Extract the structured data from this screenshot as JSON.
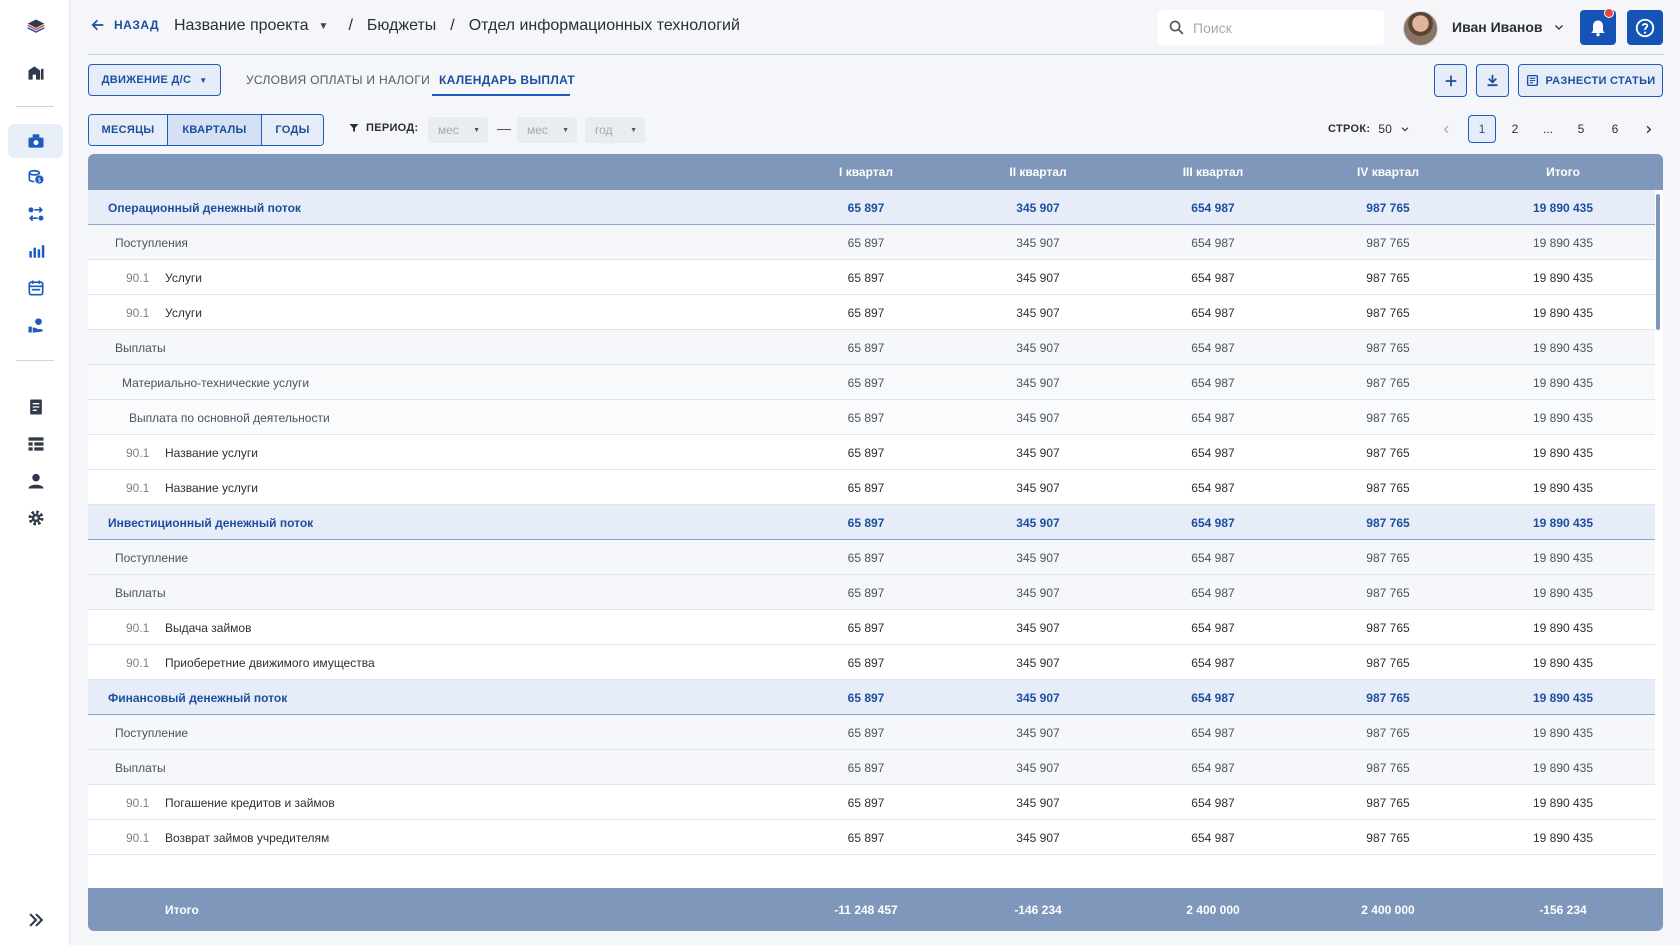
{
  "topbar": {
    "back_label": "НАЗАД",
    "breadcrumbs": [
      "Название проекта",
      "Бюджеты",
      "Отдел информационных технологий"
    ],
    "separator": "/",
    "search_placeholder": "Поиск",
    "user_name": "Иван Иванов"
  },
  "toolbar": {
    "dropdown_label": "ДВИЖЕНИЕ Д/С",
    "tabs": [
      "УСЛОВИЯ ОПЛАТЫ И НАЛОГИ",
      "КАЛЕНДАРЬ ВЫПЛАТ"
    ],
    "active_tab": "КАЛЕНДАРЬ ВЫПЛАТ",
    "action_label": "РАЗНЕСТИ СТАТЬИ"
  },
  "filters": {
    "granularity": [
      "МЕСЯЦЫ",
      "КВАРТАЛЫ",
      "ГОДЫ"
    ],
    "selected_granularity": "КВАРТАЛЫ",
    "period_label": "ПЕРИОД:",
    "from_placeholder": "мес",
    "to_placeholder": "мес",
    "year_placeholder": "год",
    "dash": "—",
    "rows_label": "СТРОК:",
    "rows_value": "50",
    "pages": [
      "1",
      "2",
      "...",
      "5",
      "6"
    ],
    "current_page": "1"
  },
  "table": {
    "columns": [
      "I квартал",
      "II квартал",
      "III квартал",
      "IV квартал",
      "Итого"
    ],
    "rows": [
      {
        "level": 0,
        "code": "",
        "name": "Операционный денежный поток",
        "values": [
          "65 897",
          "345 907",
          "654 987",
          "987 765",
          "19 890 435"
        ]
      },
      {
        "level": 1,
        "code": "",
        "name": "Поступления",
        "values": [
          "65 897",
          "345 907",
          "654 987",
          "987 765",
          "19 890 435"
        ]
      },
      {
        "level": 9,
        "code": "90.1",
        "name": "Услуги",
        "values": [
          "65 897",
          "345 907",
          "654 987",
          "987 765",
          "19 890 435"
        ]
      },
      {
        "level": 9,
        "code": "90.1",
        "name": "Услуги",
        "values": [
          "65 897",
          "345 907",
          "654 987",
          "987 765",
          "19 890 435"
        ]
      },
      {
        "level": 1,
        "code": "",
        "name": "Выплаты",
        "values": [
          "65 897",
          "345 907",
          "654 987",
          "987 765",
          "19 890 435"
        ]
      },
      {
        "level": 2,
        "code": "",
        "name": "Материально-технические услуги",
        "values": [
          "65 897",
          "345 907",
          "654 987",
          "987 765",
          "19 890 435"
        ]
      },
      {
        "level": 3,
        "code": "",
        "name": "Выплата по основной деятельности",
        "values": [
          "65 897",
          "345 907",
          "654 987",
          "987 765",
          "19 890 435"
        ]
      },
      {
        "level": 9,
        "code": "90.1",
        "name": "Название услуги",
        "values": [
          "65 897",
          "345 907",
          "654 987",
          "987 765",
          "19 890 435"
        ]
      },
      {
        "level": 9,
        "code": "90.1",
        "name": "Название услуги",
        "values": [
          "65 897",
          "345 907",
          "654 987",
          "987 765",
          "19 890 435"
        ]
      },
      {
        "level": 0,
        "code": "",
        "name": "Инвестиционный денежный поток",
        "values": [
          "65 897",
          "345 907",
          "654 987",
          "987 765",
          "19 890 435"
        ]
      },
      {
        "level": 1,
        "code": "",
        "name": "Поступление",
        "values": [
          "65 897",
          "345 907",
          "654 987",
          "987 765",
          "19 890 435"
        ]
      },
      {
        "level": 1,
        "code": "",
        "name": "Выплаты",
        "values": [
          "65 897",
          "345 907",
          "654 987",
          "987 765",
          "19 890 435"
        ]
      },
      {
        "level": 9,
        "code": "90.1",
        "name": "Выдача займов",
        "values": [
          "65 897",
          "345 907",
          "654 987",
          "987 765",
          "19 890 435"
        ]
      },
      {
        "level": 9,
        "code": "90.1",
        "name": "Приоберетние движимого имущества",
        "values": [
          "65 897",
          "345 907",
          "654 987",
          "987 765",
          "19 890 435"
        ]
      },
      {
        "level": 0,
        "code": "",
        "name": "Финансовый денежный поток",
        "values": [
          "65 897",
          "345 907",
          "654 987",
          "987 765",
          "19 890 435"
        ]
      },
      {
        "level": 1,
        "code": "",
        "name": "Поступление",
        "values": [
          "65 897",
          "345 907",
          "654 987",
          "987 765",
          "19 890 435"
        ]
      },
      {
        "level": 1,
        "code": "",
        "name": "Выплаты",
        "values": [
          "65 897",
          "345 907",
          "654 987",
          "987 765",
          "19 890 435"
        ]
      },
      {
        "level": 9,
        "code": "90.1",
        "name": "Погашение кредитов и займов",
        "values": [
          "65 897",
          "345 907",
          "654 987",
          "987 765",
          "19 890 435"
        ]
      },
      {
        "level": 9,
        "code": "90.1",
        "name": "Возврат займов учредителям",
        "values": [
          "65 897",
          "345 907",
          "654 987",
          "987 765",
          "19 890 435"
        ]
      }
    ],
    "footer": {
      "label": "Итого",
      "values": [
        "-11 248 457",
        "-146 234",
        "2 400 000",
        "2 400 000",
        "-156 234"
      ]
    }
  },
  "colors": {
    "accent": "#1d5bbf",
    "header_bg": "#7e97ba",
    "group_bg": "#e6edf8",
    "notification": "#e84545"
  },
  "icons": [
    "logo-icon",
    "home-icon",
    "budget-icon",
    "money-icon",
    "transfer-icon",
    "chart-icon",
    "calendar-icon",
    "payments-icon",
    "document-icon",
    "table-icon",
    "user-icon",
    "settings-icon",
    "expand-icon",
    "search-icon",
    "bell-icon",
    "help-icon",
    "plus-icon",
    "download-icon",
    "list-icon",
    "filter-icon"
  ]
}
